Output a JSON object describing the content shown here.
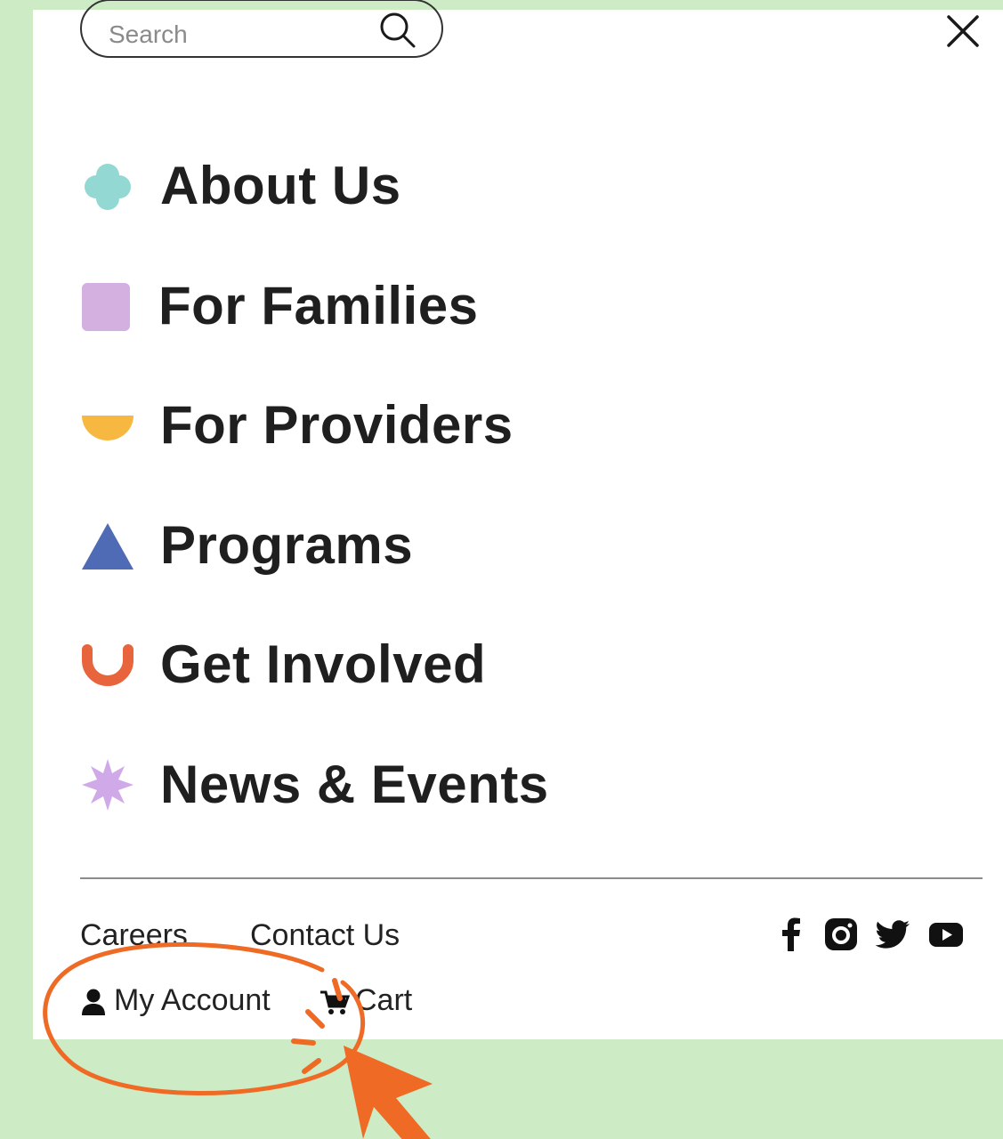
{
  "search": {
    "placeholder": "Search",
    "icon": "search-icon"
  },
  "close": {
    "icon": "close-icon"
  },
  "nav": {
    "items": [
      {
        "label": "About Us",
        "icon": "teal-quatrefoil-icon",
        "color": "#94d8d4"
      },
      {
        "label": "For Families",
        "icon": "lilac-square-icon",
        "color": "#d4b0e1"
      },
      {
        "label": "For Providers",
        "icon": "yellow-half-circle-icon",
        "color": "#f7b842"
      },
      {
        "label": "Programs",
        "icon": "blue-triangle-icon",
        "color": "#4f6bb5"
      },
      {
        "label": "Get Involved",
        "icon": "orange-smile-arc-icon",
        "color": "#e8643d"
      },
      {
        "label": "News & Events",
        "icon": "lavender-starburst-icon",
        "color": "#cfa9e8"
      }
    ]
  },
  "footer": {
    "careers": "Careers",
    "contact": "Contact Us",
    "my_account": "My Account",
    "cart": "Cart",
    "social": [
      "facebook-icon",
      "instagram-icon",
      "twitter-icon",
      "youtube-icon"
    ]
  },
  "annotation": {
    "color": "#ef6a24"
  },
  "colors": {
    "background": "#cdebc4",
    "panel": "#ffffff",
    "text": "#1f1f1f"
  }
}
